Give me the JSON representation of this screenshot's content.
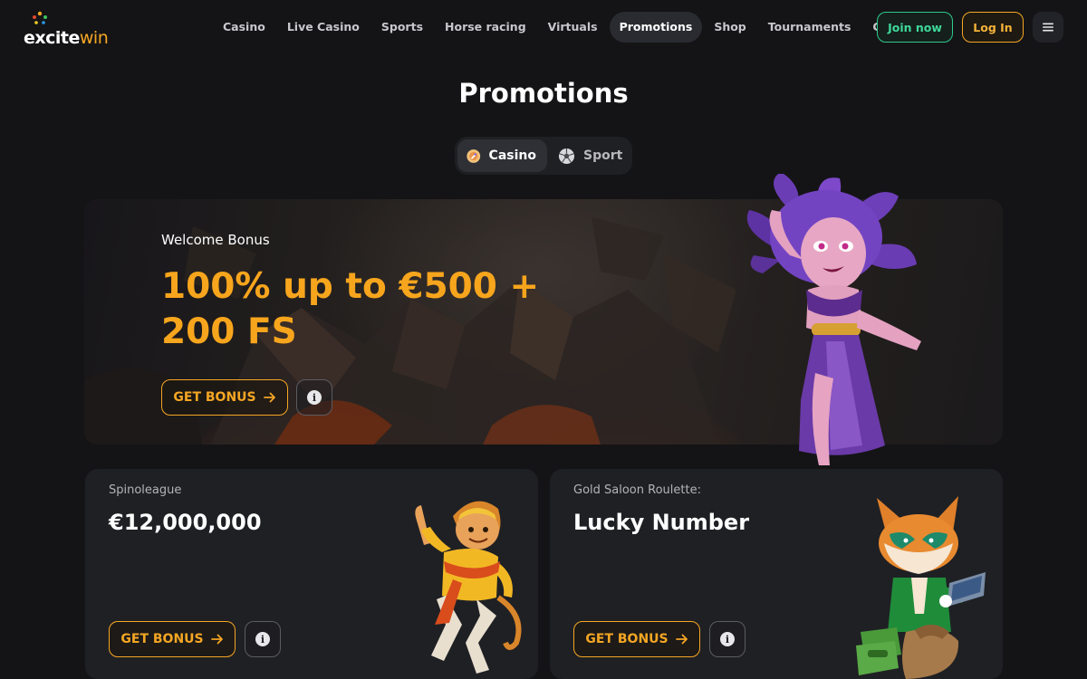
{
  "brand": {
    "logo_text_1": "excite",
    "logo_text_2": "win"
  },
  "nav": {
    "items": [
      {
        "label": "Casino",
        "active": false
      },
      {
        "label": "Live Casino",
        "active": false
      },
      {
        "label": "Sports",
        "active": false
      },
      {
        "label": "Horse racing",
        "active": false
      },
      {
        "label": "Virtuals",
        "active": false
      },
      {
        "label": "Promotions",
        "active": true
      },
      {
        "label": "Shop",
        "active": false
      },
      {
        "label": "Tournaments",
        "active": false
      },
      {
        "label": "Challenges",
        "active": false
      }
    ],
    "join_label": "Join now",
    "login_label": "Log In",
    "menu_icon": "hamburger-icon"
  },
  "page": {
    "title": "Promotions"
  },
  "toggle": {
    "options": [
      {
        "label": "Casino",
        "icon": "casino-chip-icon",
        "active": true
      },
      {
        "label": "Sport",
        "icon": "soccer-ball-icon",
        "active": false
      }
    ]
  },
  "hero": {
    "subtitle": "Welcome Bonus",
    "title": "100% up to €500 + 200 FS",
    "button_label": "GET BONUS",
    "info_icon": "info-icon"
  },
  "cards": [
    {
      "label": "Spinoleague",
      "title": "€12,000,000",
      "button_label": "GET BONUS"
    },
    {
      "label": "Gold Saloon Roulette:",
      "title": "Lucky Number",
      "button_label": "GET BONUS"
    }
  ],
  "colors": {
    "accent": "#f5a623",
    "join": "#2ec98c",
    "background": "#141416",
    "card": "#1f2024"
  }
}
